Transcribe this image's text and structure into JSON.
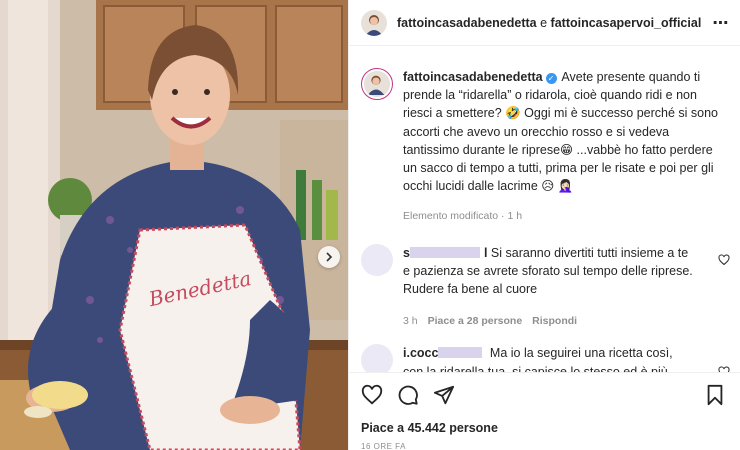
{
  "post": {
    "header": {
      "author": "fattoincasadabenedetta",
      "conjunction": "e",
      "collaborator": "fattoincasapervoi_official",
      "more_icon": "more-horizontal-icon"
    },
    "caption": {
      "username": "fattoincasadabenedetta",
      "verified_icon": "verified-badge-icon",
      "text": "Avete presente quando ti prende la “ridarella” o ridarola, cioè quando ridi e non riesci a smettere? 🤣 Oggi mi è successo perché si sono accorti che avevo un orecchio rosso e si vedeva tantissimo durante le riprese😁 ...vabbè ho fatto perdere un sacco di tempo a tutti, prima per le risate e poi per gli occhi lucidi dalle lacrime 😥 🤦🏻‍♀️",
      "meta": "Elemento modificato · 1 h"
    },
    "comments": [
      {
        "username_visible": "s",
        "username_tail": "l",
        "text": "Si saranno divertiti tutti insieme a te e pazienza se avrete sforato sul tempo delle riprese. Rudere fa bene al cuore",
        "time": "3 h",
        "likes": "Piace a 28 persone",
        "reply": "Rispondi"
      },
      {
        "username_visible": "i.cocc",
        "username_tail": "",
        "text": "Ma io la seguirei una ricetta così, con la ridarella tua, si capisce lo stesso ed è più divertente 😂❤️",
        "time": "",
        "likes": "",
        "reply": ""
      }
    ],
    "likes_text": "Piace a 45.442 persone",
    "date": "16 ORE FA"
  },
  "colors": {
    "accent": "#3897f0",
    "muted": "#8e8e8e",
    "text": "#262626",
    "border": "#efefef",
    "story_ring": "#c13584"
  }
}
